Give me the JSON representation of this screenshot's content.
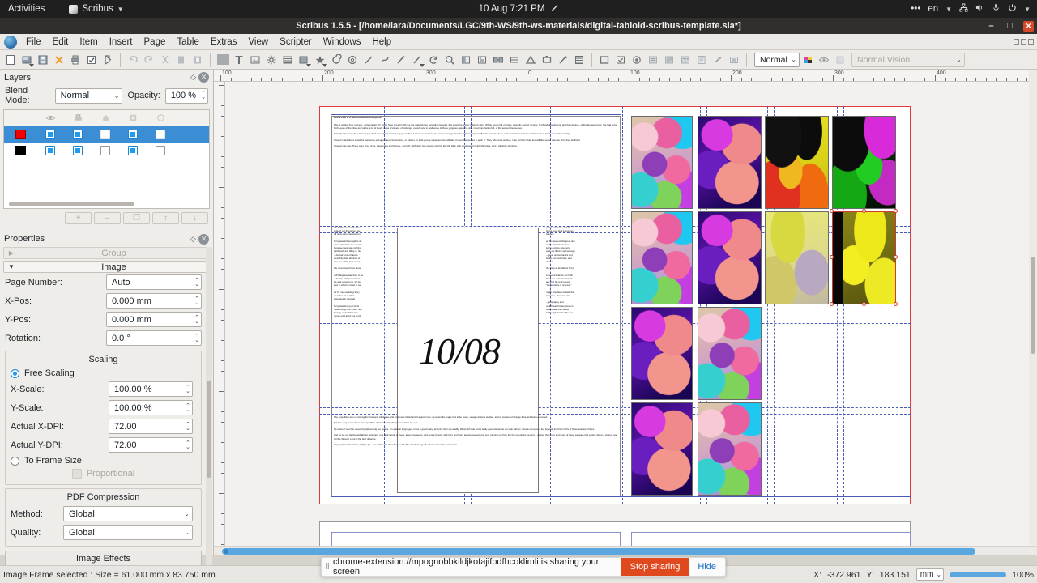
{
  "gnome": {
    "activities": "Activities",
    "app_name": "Scribus",
    "clock": "10 Aug  7:21 PM",
    "keyboard": "en",
    "tray_icons": [
      "more-icon",
      "network-icon",
      "volume-icon",
      "microphone-icon",
      "power-icon"
    ]
  },
  "titlebar": {
    "title": "Scribus 1.5.5 - [/home/lara/Documents/LGC/9th-WS/9th-ws-materials/digital-tabloid-scribus-template.sla*]",
    "minimize": "–",
    "maximize": "□",
    "close": "✕"
  },
  "menubar": {
    "items": [
      "File",
      "Edit",
      "Item",
      "Insert",
      "Page",
      "Table",
      "Extras",
      "View",
      "Scripter",
      "Windows",
      "Help"
    ]
  },
  "toolbar": {
    "view_mode": "Normal",
    "vision_mode": "Normal Vision",
    "groups": [
      {
        "name": "file",
        "icons": [
          "new-document-icon",
          "open-document-icon",
          "save-icon",
          "close-document-icon",
          "print-icon",
          "preflight-verifier-icon",
          "export-pdf-icon"
        ]
      },
      {
        "name": "edit",
        "icons": [
          "undo-icon",
          "redo-icon",
          "cut-icon",
          "copy-icon",
          "paste-icon"
        ]
      },
      {
        "name": "insert",
        "icons": [
          "insert-shape-icon",
          "insert-text-frame-icon",
          "insert-image-frame-icon",
          "insert-render-frame-icon",
          "insert-table-icon",
          "insert-polygon-icon",
          "insert-arc-icon",
          "insert-spiral-icon",
          "insert-line-icon",
          "insert-bezier-icon",
          "insert-freehand-icon",
          "insert-calligraphic-icon",
          "rotate-item-icon",
          "zoom-icon",
          "edit-contents-icon",
          "edit-text-story-editor-icon",
          "link-text-frames-icon",
          "unlink-text-frames-icon",
          "measurements-icon",
          "copy-item-properties-icon",
          "eyedropper-icon",
          "table-tool-icon"
        ]
      },
      {
        "name": "pdf",
        "icons": [
          "pdf-push-button-icon",
          "pdf-check-box-icon",
          "pdf-radio-button-icon",
          "pdf-text-field-icon",
          "pdf-list-box-icon",
          "pdf-combo-box-icon",
          "pdf-text-annotation-icon",
          "pdf-link-annotation-icon",
          "pdf-3d-annotation-icon"
        ]
      }
    ]
  },
  "layers_panel": {
    "title": "Layers",
    "blend_mode_label": "Blend Mode:",
    "blend_mode_value": "Normal",
    "opacity_label": "Opacity:",
    "opacity_value": "100 %",
    "column_icons": [
      "layer-color-swatch",
      "visible-eye-icon",
      "print-layer-icon",
      "lock-layer-icon",
      "text-flow-icon",
      "outline-layer-icon"
    ],
    "rows": [
      {
        "color": "#f20000",
        "selected": true,
        "visible": true,
        "print": true,
        "locked": false,
        "flow": true,
        "outline": false
      },
      {
        "color": "#000000",
        "selected": false,
        "visible": true,
        "print": true,
        "locked": false,
        "flow": true,
        "outline": false
      }
    ],
    "buttons": [
      "add-layer-button",
      "remove-layer-button",
      "duplicate-layer-button",
      "raise-layer-button",
      "lower-layer-button"
    ],
    "button_labels": [
      "+",
      "–",
      "❐",
      "↑",
      "↓"
    ]
  },
  "properties_panel": {
    "title": "Properties",
    "section_group": "Group",
    "section_image": "Image",
    "fields": [
      {
        "label": "Page Number:",
        "value": "Auto"
      },
      {
        "label": "X-Pos:",
        "value": "0.000 mm"
      },
      {
        "label": "Y-Pos:",
        "value": "0.000 mm"
      },
      {
        "label": "Rotation:",
        "value": "0.0 °"
      }
    ],
    "scaling": {
      "title": "Scaling",
      "free_scaling_label": "Free Scaling",
      "free_scaling_selected": true,
      "x_scale_label": "X-Scale:",
      "x_scale_value": "100.00 %",
      "y_scale_label": "Y-Scale:",
      "y_scale_value": "100.00 %",
      "x_dpi_label": "Actual X-DPI:",
      "x_dpi_value": "72.00",
      "y_dpi_label": "Actual Y-DPI:",
      "y_dpi_value": "72.00",
      "to_frame_size_label": "To Frame Size",
      "to_frame_size_selected": false,
      "proportional_label": "Proportional",
      "proportional_enabled": false
    },
    "pdf_compression": {
      "title": "PDF Compression",
      "method_label": "Method:",
      "method_value": "Global",
      "quality_label": "Quality:",
      "quality_value": "Global"
    },
    "image_effects_label": "Image Effects"
  },
  "statusbar": {
    "selection_info": "Image Frame selected : Size = 61.000 mm x 83.750 mm",
    "x_label": "X:",
    "x_value": "-372.961",
    "y_label": "Y:",
    "y_value": "183.151",
    "unit": "mm",
    "zoom": "100%"
  },
  "share_toast": {
    "message": "chrome-extension://mpognobbkildjkofajifpdfhcoklimli is sharing your screen.",
    "stop_label": "Stop sharing",
    "hide_label": "Hide"
  },
  "ruler": {
    "horizontal_labels": [
      "100",
      "200",
      "300",
      "0",
      "100",
      "200",
      "300",
      "400"
    ],
    "unit": "mm"
  },
  "document": {
    "chapter_heading": "CHAPTER 1. A Not Unnatural Enterprise",
    "date_frame_text": "10/08",
    "column_left": [
      "This is written from memory, unfortunately. If I could have brought with me the material I so carefully prepared, this would be a very different story. Whole books full of notes, carefully copied records, firsthand descriptions, and the pictures—that's the worst loss. We had some bird's-eyes of the cities and parks; a lot of lovely views of streets, of buildings, outside and in, and some of those gorgeous gardens, and, most important of all, of the women themselves.",
      "Nobody will ever believe how they looked. Descriptions aren't any good when it comes to women, and I never was good at descriptions anyhow. But it's got to be done somehow; the rest of the world needs to know about that country.",
      "I haven't said where it was for fear some self-appointed missionaries, or traders, or land-greedy expansionists, will take it upon themselves to push in. They will not be wanted, I can tell them that, and will fare worse than we did if they do find it.",
      "It began this way. There were three of us, classmates and friends—Terry O. Nicholson (we used to call him the Old Nick, with good reason), Jeff Margrave, and I, Vandyck Jennings."
    ],
    "column_mid_left": [
      "We had known each other",
      "spite of our differences we",
      "All of us were interested in",
      "Terry was rich enough to do",
      "was exploration. He used to",
      "because there was nothing",
      "patchwork and filling in, he",
      "—he had a lot of talents",
      "electricity. Had all kinds of",
      "was one of the best of our",
      "We never could have done",
      "Jeff Margrave was born to be",
      "—but his folks persuaded",
      "He was a good one, for he",
      "was in what he loved to call",
      "As for me, sociology's my",
      "up with a lot of other",
      "interested in them all.",
      "Terry was strong on facts",
      "meteorology and those; Jeff",
      "biology, and I didn't care",
      "money and as for me, I got"
    ],
    "column_mid_right": [
      "years and years, and in",
      "had a good deal in common.",
      "science.",
      "as he pleased. His great aim",
      "make all kinds of a row",
      "left to explore now, only",
      "said. He filled in well enough",
      "—great on mechanics and",
      "boats and motorcars, and",
      "airmen.",
      "the thing at all without Terry.",
      "a poet, a botanist—or both",
      "him to be a doctor instead",
      "age, but his real interest",
      "\"the wonders of science.\"",
      "major. You have to back that",
      "sciences, of course. I'm",
      "—geography and",
      "could beat him any time on",
      "what it was they talked",
      "in through Terry's influence."
    ],
    "column_bottom": [
      "The expedition was up among the thousand tributaries and enormous hinterland of a great river, up where the maps had to be made, savage dialects studied, and all manner of strange flora and fauna expected.",
      "But this story is not about that expedition. That was only the merest starter for ours.",
      "My interest was first roused by talk among our guides. I'm quick at languages, know a good many, and pick them up readily. What with that and a really good interpreter we took with us, I made out quite a few legends and folk myths of these scattered tribes.",
      "And as we got farther and farther upstream, in a dark tangle of rivers, lakes, morasses, and dense forests, with here and there an unexpected long spur running out from the big mountains beyond, I noticed that more and more of these savages had a story about a strange and terrible Woman Land in the high distance.",
      "\"Up yonder,\" \"Over there,\" \"Way up\"—was all the direction they could offer, but their legends all agreed on the main point"
    ],
    "image_grid": {
      "rows": 4,
      "cols": 4,
      "selected_cell": {
        "row": 2,
        "col": 4
      },
      "cells": [
        [
          "mosaic-pink",
          "purple-fish",
          "yellow-black",
          "green-black"
        ],
        [
          "mosaic-pink",
          "purple-fish",
          "yellow-pale",
          "yellow-olive-selected"
        ],
        [
          "purple-fish",
          "mosaic-pink",
          "empty",
          "empty"
        ],
        [
          "purple-fish",
          "mosaic-pink",
          "empty",
          "empty"
        ]
      ]
    }
  }
}
